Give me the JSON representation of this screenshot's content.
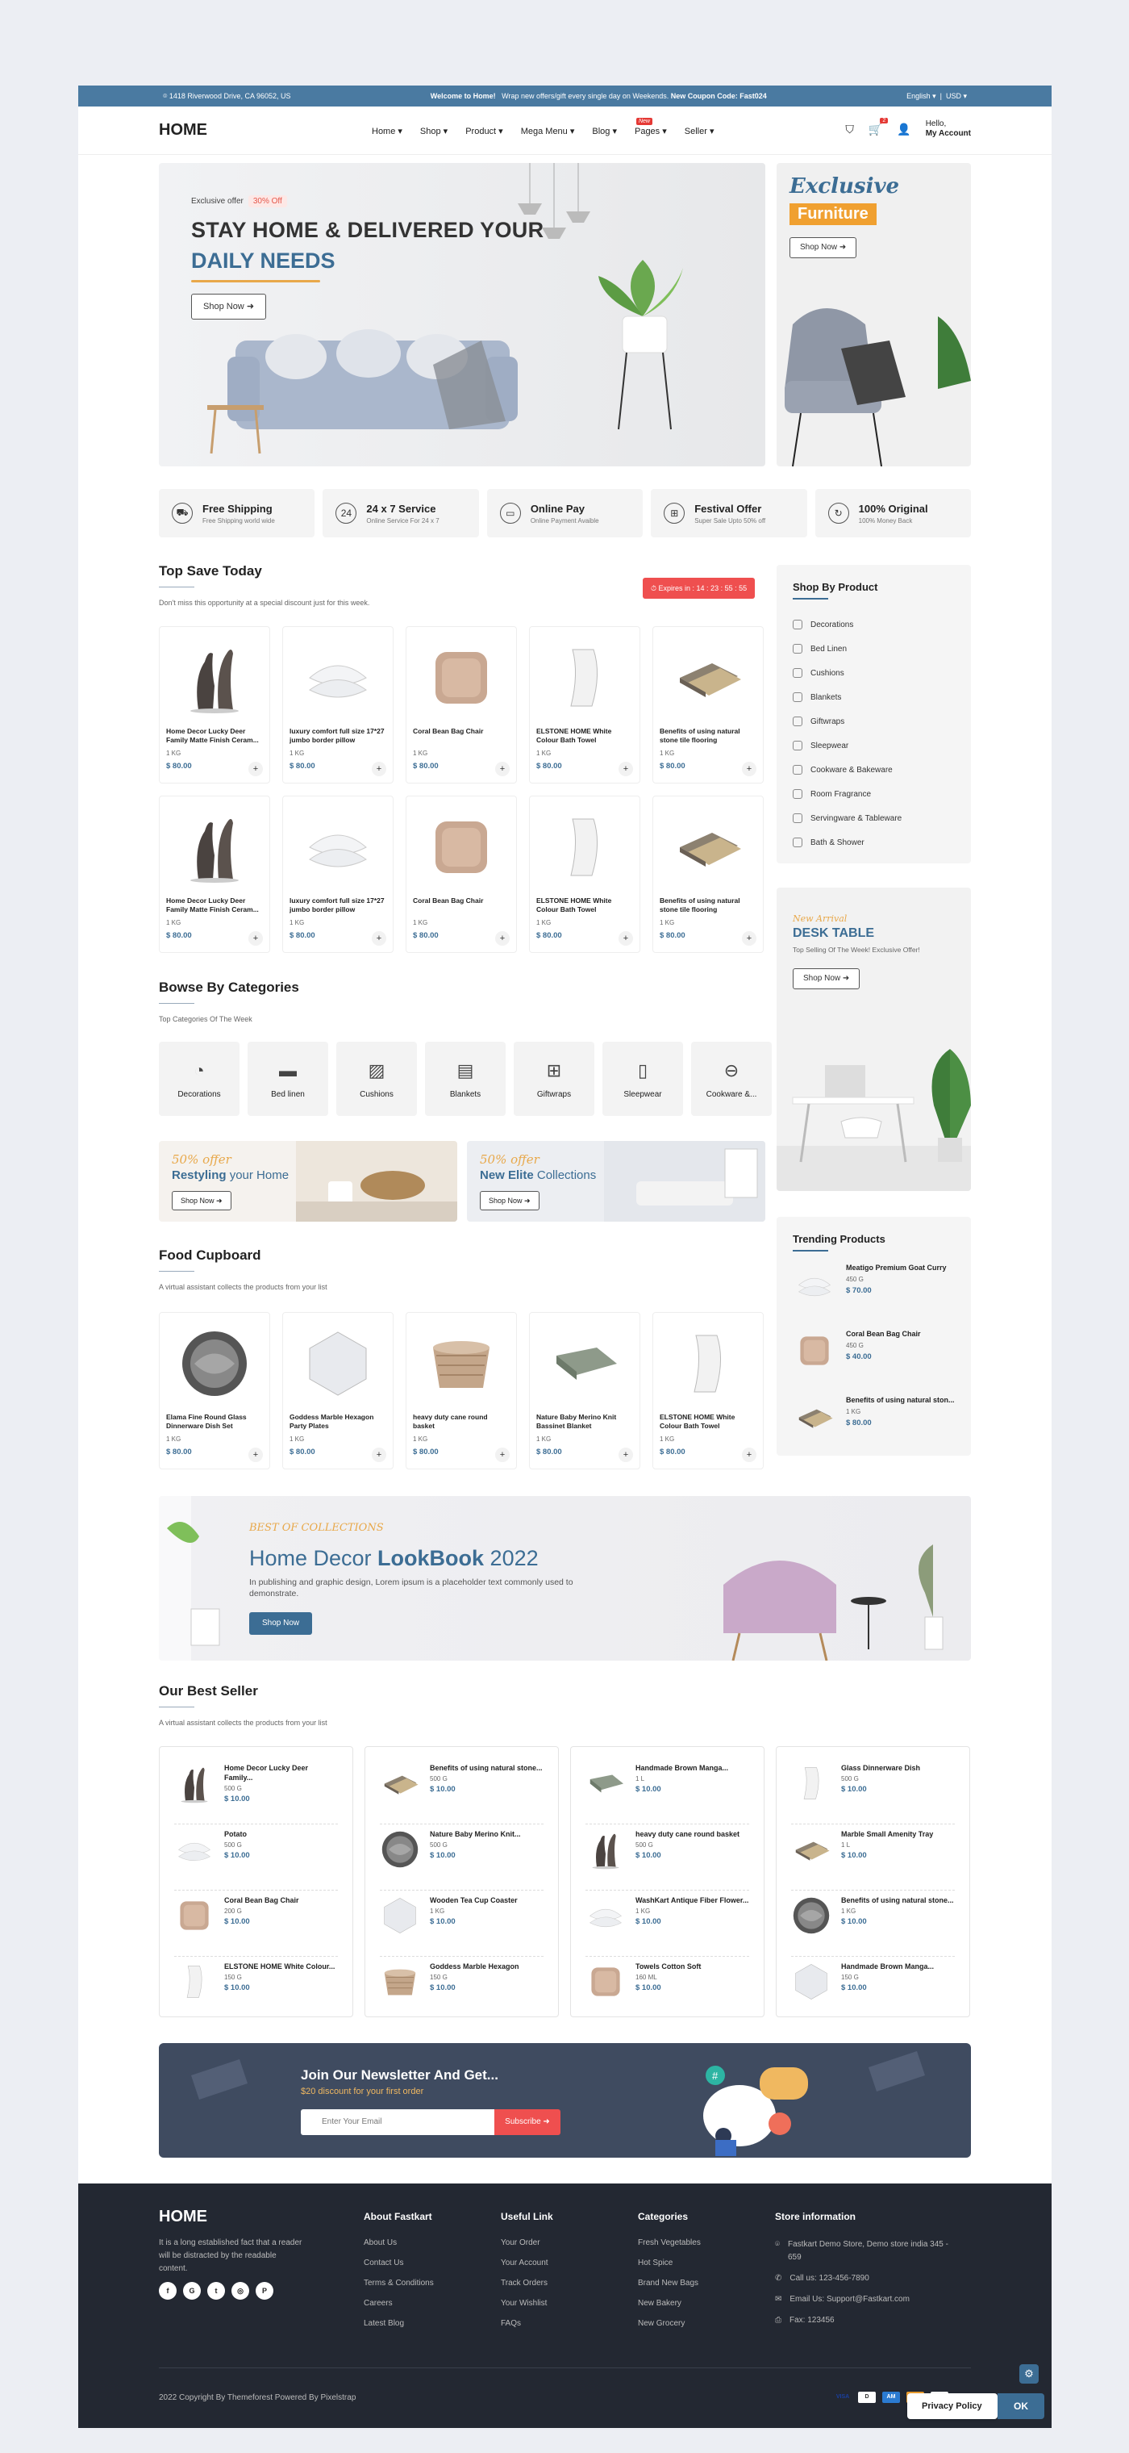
{
  "topbar": {
    "address": "1418 Riverwood Drive, CA 96052, US",
    "welcome": "Welcome to Home!",
    "offer": "Wrap new offers/gift every single day on Weekends.",
    "coupon": "New Coupon Code: Fast024",
    "language": "English",
    "currency": "USD"
  },
  "header": {
    "logo": "HOME",
    "nav": [
      "Home",
      "Shop",
      "Product",
      "Mega Menu",
      "Blog",
      "Pages",
      "Seller"
    ],
    "new_badge": "New",
    "cart_count": "2",
    "hello": "Hello,",
    "account": "My Account"
  },
  "hero": {
    "tag": "Exclusive offer",
    "discount": "30% Off",
    "title1": "STAY HOME & DELIVERED YOUR",
    "title2": "DAILY NEEDS",
    "button": "Shop Now"
  },
  "side_banner": {
    "title1": "Exclusive",
    "title2": "Furniture",
    "button": "Shop Now"
  },
  "services": [
    {
      "title": "Free Shipping",
      "sub": "Free Shipping world wide",
      "icon": "truck-icon"
    },
    {
      "title": "24 x 7 Service",
      "sub": "Online Service For 24 x 7",
      "icon": "clock-icon"
    },
    {
      "title": "Online Pay",
      "sub": "Online Payment Avaible",
      "icon": "card-icon"
    },
    {
      "title": "Festival Offer",
      "sub": "Super Sale Upto 50% off",
      "icon": "gift-icon"
    },
    {
      "title": "100% Original",
      "sub": "100% Money Back",
      "icon": "refresh-icon"
    }
  ],
  "top_save": {
    "title": "Top Save Today",
    "sub": "Don't miss this opportunity at a special discount just for this week.",
    "timer": "Expires in : 14 : 23 : 55 : 55"
  },
  "products": [
    {
      "name": "Home Decor Lucky Deer Family Matte Finish Ceram...",
      "qty": "1 KG",
      "price": "$ 80.00"
    },
    {
      "name": "luxury comfort full size 17*27 jumbo border pillow",
      "qty": "1 KG",
      "price": "$ 80.00"
    },
    {
      "name": "Coral Bean Bag Chair",
      "qty": "1 KG",
      "price": "$ 80.00"
    },
    {
      "name": "ELSTONE HOME White Colour Bath Towel",
      "qty": "1 KG",
      "price": "$ 80.00"
    },
    {
      "name": "Benefits of using natural stone tile flooring",
      "qty": "1 KG",
      "price": "$ 80.00"
    },
    {
      "name": "Home Decor Lucky Deer Family Matte Finish Ceram...",
      "qty": "1 KG",
      "price": "$ 80.00"
    },
    {
      "name": "luxury comfort full size 17*27 jumbo border pillow",
      "qty": "1 KG",
      "price": "$ 80.00"
    },
    {
      "name": "Coral Bean Bag Chair",
      "qty": "1 KG",
      "price": "$ 80.00"
    },
    {
      "name": "ELSTONE HOME White Colour Bath Towel",
      "qty": "1 KG",
      "price": "$ 80.00"
    },
    {
      "name": "Benefits of using natural stone tile flooring",
      "qty": "1 KG",
      "price": "$ 80.00"
    }
  ],
  "shop_by": {
    "title": "Shop By Product",
    "items": [
      "Decorations",
      "Bed Linen",
      "Cushions",
      "Blankets",
      "Giftwraps",
      "Sleepwear",
      "Cookware & Bakeware",
      "Room Fragrance",
      "Servingware & Tableware",
      "Bath & Shower"
    ]
  },
  "desk": {
    "tag": "New Arrival",
    "title": "DESK TABLE",
    "sub": "Top Selling Of The Week! Exclusive Offer!",
    "button": "Shop Now"
  },
  "categories": {
    "title": "Bowse By Categories",
    "sub": "Top Categories Of The Week",
    "items": [
      "Decorations",
      "Bed linen",
      "Cushions",
      "Blankets",
      "Giftwraps",
      "Sleepwear",
      "Cookware &..."
    ]
  },
  "offers": [
    {
      "off": "50% offer",
      "t1": "Restyling",
      "t2": "your Home",
      "button": "Shop Now"
    },
    {
      "off": "50% offer",
      "t1": "New Elite",
      "t2": "Collections",
      "button": "Shop Now"
    }
  ],
  "food": {
    "title": "Food Cupboard",
    "sub": "A virtual assistant collects the products from your list",
    "items": [
      {
        "name": "Elama Fine Round Glass Dinnerware Dish Set",
        "qty": "1 KG",
        "price": "$ 80.00"
      },
      {
        "name": "Goddess Marble Hexagon Party Plates",
        "qty": "1 KG",
        "price": "$ 80.00"
      },
      {
        "name": "heavy duty cane round basket",
        "qty": "1 KG",
        "price": "$ 80.00"
      },
      {
        "name": "Nature Baby Merino Knit Bassinet Blanket",
        "qty": "1 KG",
        "price": "$ 80.00"
      },
      {
        "name": "ELSTONE HOME White Colour Bath Towel",
        "qty": "1 KG",
        "price": "$ 80.00"
      }
    ]
  },
  "trending": {
    "title": "Trending Products",
    "items": [
      {
        "name": "Meatigo Premium Goat Curry",
        "qty": "450 G",
        "price": "$ 70.00"
      },
      {
        "name": "Coral Bean Bag Chair",
        "qty": "450 G",
        "price": "$ 40.00"
      },
      {
        "name": "Benefits of using natural ston...",
        "qty": "1 KG",
        "price": "$ 80.00"
      }
    ]
  },
  "lookbook": {
    "tag": "BEST OF COLLECTIONS",
    "title1": "Home Decor ",
    "title2": "LookBook",
    "title3": " 2022",
    "text": "In publishing and graphic design, Lorem ipsum is a placeholder text commonly used to demonstrate.",
    "button": "Shop Now"
  },
  "best": {
    "title": "Our Best Seller",
    "sub": "A virtual assistant collects the products from your list",
    "cols": [
      [
        {
          "n": "Home Decor Lucky Deer Family...",
          "q": "500 G",
          "p": "$ 10.00"
        },
        {
          "n": "Potato",
          "q": "500 G",
          "p": "$ 10.00"
        },
        {
          "n": "Coral Bean Bag Chair",
          "q": "200 G",
          "p": "$ 10.00"
        },
        {
          "n": "ELSTONE HOME White Colour...",
          "q": "150 G",
          "p": "$ 10.00"
        }
      ],
      [
        {
          "n": "Benefits of using natural stone...",
          "q": "500 G",
          "p": "$ 10.00"
        },
        {
          "n": "Nature Baby Merino Knit...",
          "q": "500 G",
          "p": "$ 10.00"
        },
        {
          "n": "Wooden Tea Cup Coaster",
          "q": "1 KG",
          "p": "$ 10.00"
        },
        {
          "n": "Goddess Marble Hexagon",
          "q": "150 G",
          "p": "$ 10.00"
        }
      ],
      [
        {
          "n": "Handmade Brown Manga...",
          "q": "1 L",
          "p": "$ 10.00"
        },
        {
          "n": "heavy duty cane round basket",
          "q": "500 G",
          "p": "$ 10.00"
        },
        {
          "n": "WashKart Antique Fiber Flower...",
          "q": "1 KG",
          "p": "$ 10.00"
        },
        {
          "n": "Towels Cotton Soft",
          "q": "160 ML",
          "p": "$ 10.00"
        }
      ],
      [
        {
          "n": "Glass Dinnerware Dish",
          "q": "500 G",
          "p": "$ 10.00"
        },
        {
          "n": "Marble Small Amenity Tray",
          "q": "1 L",
          "p": "$ 10.00"
        },
        {
          "n": "Benefits of using natural stone...",
          "q": "1 KG",
          "p": "$ 10.00"
        },
        {
          "n": "Handmade Brown Manga...",
          "q": "150 G",
          "p": "$ 10.00"
        }
      ]
    ]
  },
  "newsletter": {
    "title": "Join Our Newsletter And Get...",
    "discount": "$20 discount for your first order",
    "placeholder": "Enter Your Email",
    "button": "Subscribe"
  },
  "footer": {
    "logo": "HOME",
    "desc": "It is a long established fact that a reader will be distracted by the readable content.",
    "about": {
      "title": "About Fastkart",
      "links": [
        "About Us",
        "Contact Us",
        "Terms & Conditions",
        "Careers",
        "Latest Blog"
      ]
    },
    "useful": {
      "title": "Useful Link",
      "links": [
        "Your Order",
        "Your Account",
        "Track Orders",
        "Your Wishlist",
        "FAQs"
      ]
    },
    "cats": {
      "title": "Categories",
      "links": [
        "Fresh Vegetables",
        "Hot Spice",
        "Brand New Bags",
        "New Bakery",
        "New Grocery"
      ]
    },
    "store": {
      "title": "Store information",
      "address": "Fastkart Demo Store, Demo store india 345 - 659",
      "call": "Call us: 123-456-7890",
      "email": "Email Us: Support@Fastkart.com",
      "fax": "Fax: 123456"
    },
    "copyright": "2022 Copyright By Themeforest Powered By Pixelstrap"
  },
  "cookie": {
    "policy": "Privacy Policy",
    "ok": "OK"
  }
}
